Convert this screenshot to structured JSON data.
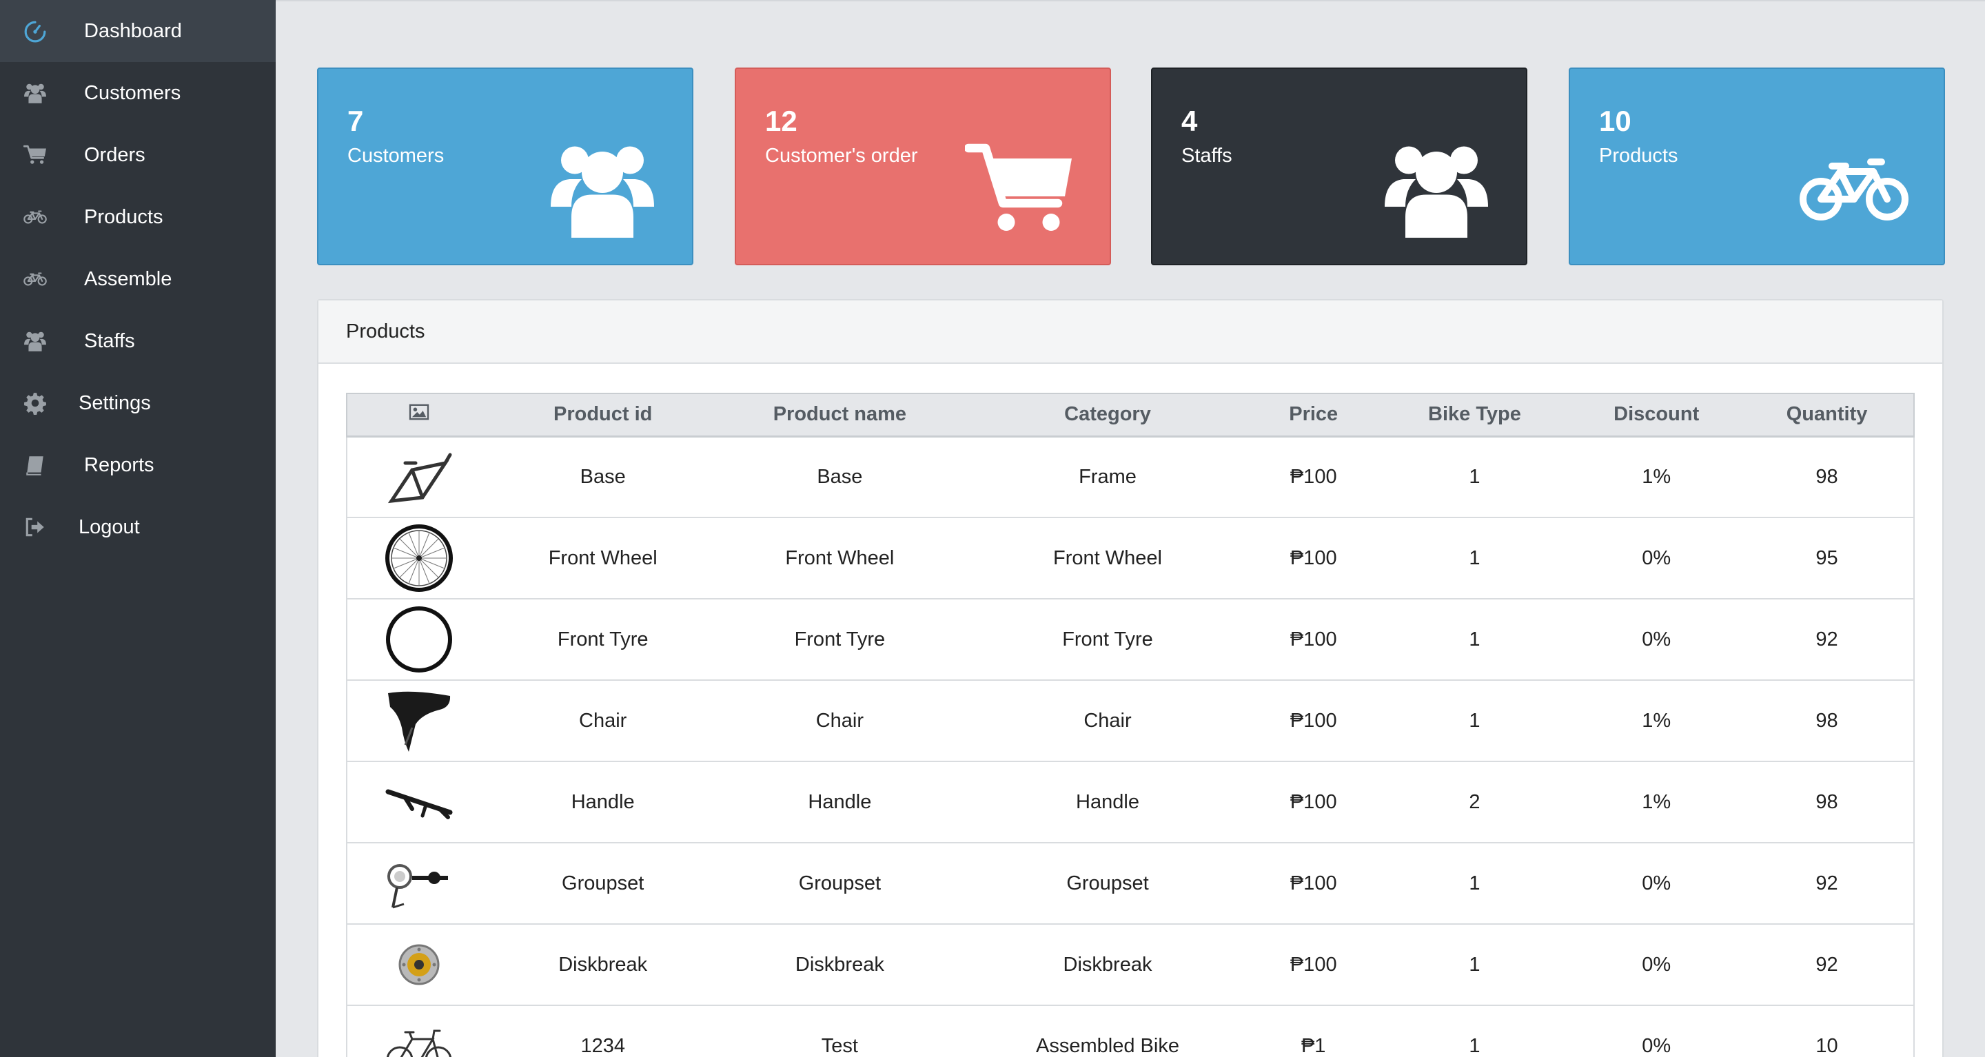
{
  "sidebar": {
    "items": [
      {
        "label": "Dashboard",
        "icon": "dashboard-icon",
        "active": true
      },
      {
        "label": "Customers",
        "icon": "users-icon"
      },
      {
        "label": "Orders",
        "icon": "cart-icon"
      },
      {
        "label": "Products",
        "icon": "bicycle-icon"
      },
      {
        "label": "Assemble",
        "icon": "bicycle-icon"
      },
      {
        "label": "Staffs",
        "icon": "users-icon"
      },
      {
        "label": "Settings",
        "icon": "gear-icon"
      },
      {
        "label": "Reports",
        "icon": "book-icon"
      },
      {
        "label": "Logout",
        "icon": "sign-out-icon"
      }
    ]
  },
  "cards": [
    {
      "count": "7",
      "label": "Customers",
      "icon": "users-icon",
      "color": "#4ea6d6"
    },
    {
      "count": "12",
      "label": "Customer's order",
      "icon": "cart-icon",
      "color": "#e8716e"
    },
    {
      "count": "4",
      "label": "Staffs",
      "icon": "users-icon",
      "color": "#2f343a"
    },
    {
      "count": "10",
      "label": "Products",
      "icon": "bicycle-icon",
      "color": "#4ea6d6"
    }
  ],
  "products_panel": {
    "title": "Products",
    "columns": [
      "Product id",
      "Product name",
      "Category",
      "Price",
      "Bike Type",
      "Discount",
      "Quantity"
    ],
    "rows": [
      {
        "image": "bike-frame-thumbnail",
        "id": "Base",
        "name": "Base",
        "category": "Frame",
        "price": "₱100",
        "bike_type": "1",
        "discount": "1%",
        "quantity": "98"
      },
      {
        "image": "front-wheel-thumbnail",
        "id": "Front Wheel",
        "name": "Front Wheel",
        "category": "Front Wheel",
        "price": "₱100",
        "bike_type": "1",
        "discount": "0%",
        "quantity": "95"
      },
      {
        "image": "front-tyre-thumbnail",
        "id": "Front Tyre",
        "name": "Front Tyre",
        "category": "Front Tyre",
        "price": "₱100",
        "bike_type": "1",
        "discount": "0%",
        "quantity": "92"
      },
      {
        "image": "saddle-thumbnail",
        "id": "Chair",
        "name": "Chair",
        "category": "Chair",
        "price": "₱100",
        "bike_type": "1",
        "discount": "1%",
        "quantity": "98"
      },
      {
        "image": "handlebar-thumbnail",
        "id": "Handle",
        "name": "Handle",
        "category": "Handle",
        "price": "₱100",
        "bike_type": "2",
        "discount": "1%",
        "quantity": "98"
      },
      {
        "image": "groupset-thumbnail",
        "id": "Groupset",
        "name": "Groupset",
        "category": "Groupset",
        "price": "₱100",
        "bike_type": "1",
        "discount": "0%",
        "quantity": "92"
      },
      {
        "image": "disc-brake-thumbnail",
        "id": "Diskbreak",
        "name": "Diskbreak",
        "category": "Diskbreak",
        "price": "₱100",
        "bike_type": "1",
        "discount": "0%",
        "quantity": "92"
      },
      {
        "image": "assembled-bike-thumbnail",
        "id": "1234",
        "name": "Test",
        "category": "Assembled Bike",
        "price": "₱1",
        "bike_type": "1",
        "discount": "0%",
        "quantity": "10"
      }
    ]
  }
}
